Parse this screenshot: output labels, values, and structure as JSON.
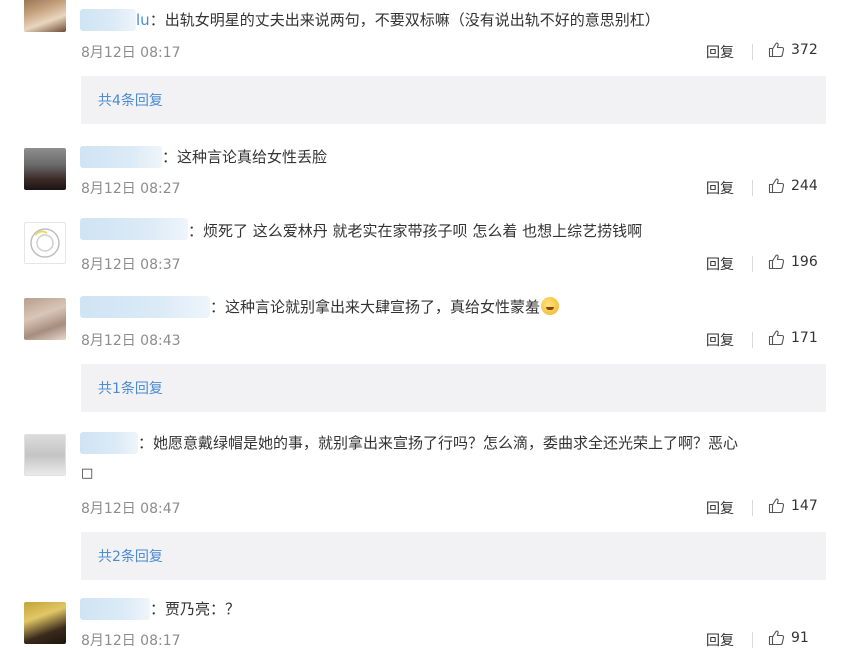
{
  "comments": [
    {
      "name_fragment": "lu",
      "text": "出轨女明星的丈夫出来说两句，不要双标嘛（没有说出轨不好的意思别杠）",
      "time": "8月12日 08:17",
      "reply_label": "回复",
      "likes": "372",
      "more_replies": "共4条回复"
    },
    {
      "text": "这种言论真给女性丢脸",
      "time": "8月12日 08:27",
      "reply_label": "回复",
      "likes": "244"
    },
    {
      "text": "烦死了  这么爱林丹 就老实在家带孩子呗  怎么着  也想上综艺捞钱啊",
      "time": "8月12日 08:37",
      "reply_label": "回复",
      "likes": "196"
    },
    {
      "text": "这种言论就别拿出来大肆宣扬了，真给女性蒙羞",
      "time": "8月12日 08:43",
      "reply_label": "回复",
      "likes": "171",
      "more_replies": "共1条回复"
    },
    {
      "text": "她愿意戴绿帽是她的事，就别拿出来宣扬了行吗？怎么滴，委曲求全还光荣上了啊？恶心",
      "text_line2": "□",
      "time": "8月12日 08:47",
      "reply_label": "回复",
      "likes": "147",
      "more_replies": "共2条回复"
    },
    {
      "text": "贾乃亮：？",
      "time": "8月12日 08:17",
      "reply_label": "回复",
      "likes": "91"
    }
  ],
  "colors": {
    "link": "#4a8bd1",
    "time": "#8c8c8c",
    "reply_box_bg": "#f2f2f5",
    "name_blur": "#cfe4f4"
  },
  "icons": {
    "like": "thumbs-up-icon"
  }
}
